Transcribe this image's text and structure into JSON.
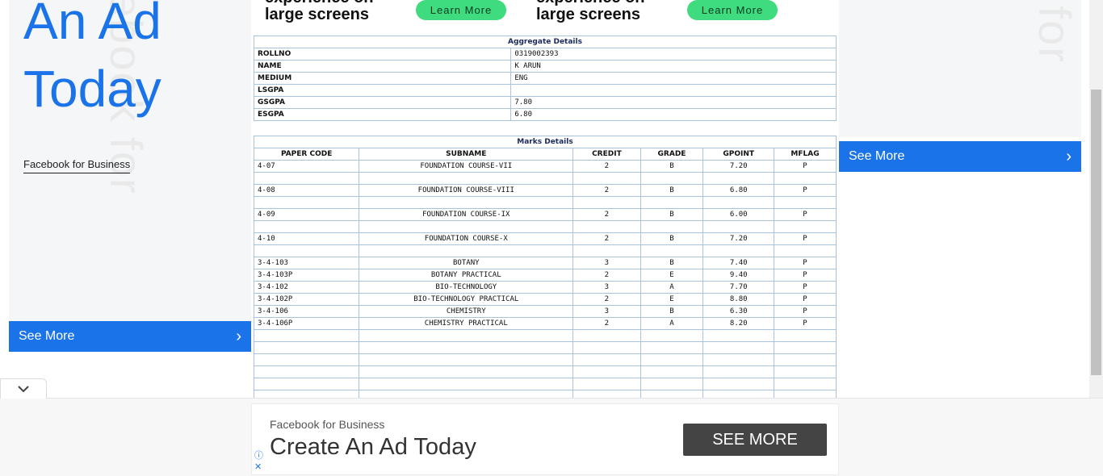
{
  "left_ad": {
    "headline_line1": "An Ad",
    "headline_line2": "Today",
    "vertical_text": "ebook for",
    "brand_link": "Facebook for Business",
    "see_more": "See More",
    "chevron": "›"
  },
  "right_ad": {
    "vertical_text": "k for",
    "see_more": "See More",
    "chevron": "›"
  },
  "top_banner": {
    "text_partial": "experience on",
    "text_line2": "large screens",
    "button_label": "Learn More"
  },
  "aggregate": {
    "title": "Aggregate Details",
    "rows": [
      {
        "label": "ROLLNO",
        "value": "0319002393"
      },
      {
        "label": "NAME",
        "value": "K ARUN"
      },
      {
        "label": "MEDIUM",
        "value": "ENG"
      },
      {
        "label": "LSGPA",
        "value": ""
      },
      {
        "label": "GSGPA",
        "value": "7.80"
      },
      {
        "label": "ESGPA",
        "value": "6.80"
      }
    ]
  },
  "marks": {
    "title": "Marks Details",
    "headers": [
      "PAPER CODE",
      "SUBNAME",
      "CREDIT",
      "GRADE",
      "GPOINT",
      "MFLAG"
    ],
    "rows": [
      [
        "4-07",
        "FOUNDATION COURSE-VII",
        "2",
        "B",
        "7.20",
        "P"
      ],
      [
        "",
        "",
        "",
        "",
        "",
        ""
      ],
      [
        "4-08",
        "FOUNDATION COURSE-VIII",
        "2",
        "B",
        "6.80",
        "P"
      ],
      [
        "",
        "",
        "",
        "",
        "",
        ""
      ],
      [
        "4-09",
        "FOUNDATION COURSE-IX",
        "2",
        "B",
        "6.00",
        "P"
      ],
      [
        "",
        "",
        "",
        "",
        "",
        ""
      ],
      [
        "4-10",
        "FOUNDATION COURSE-X",
        "2",
        "B",
        "7.20",
        "P"
      ],
      [
        "",
        "",
        "",
        "",
        "",
        ""
      ],
      [
        "3-4-103",
        "BOTANY",
        "3",
        "B",
        "7.40",
        "P"
      ],
      [
        "3-4-103P",
        "BOTANY PRACTICAL",
        "2",
        "E",
        "9.40",
        "P"
      ],
      [
        "3-4-102",
        "BIO-TECHNOLOGY",
        "3",
        "A",
        "7.70",
        "P"
      ],
      [
        "3-4-102P",
        "BIO-TECHNOLOGY PRACTICAL",
        "2",
        "E",
        "8.80",
        "P"
      ],
      [
        "3-4-106",
        "CHEMISTRY",
        "3",
        "B",
        "6.30",
        "P"
      ],
      [
        "3-4-106P",
        "CHEMISTRY PRACTICAL",
        "2",
        "A",
        "8.20",
        "P"
      ],
      [
        "",
        "",
        "",
        "",
        "",
        ""
      ],
      [
        "",
        "",
        "",
        "",
        "",
        ""
      ],
      [
        "",
        "",
        "",
        "",
        "",
        ""
      ],
      [
        "",
        "",
        "",
        "",
        "",
        ""
      ],
      [
        "",
        "",
        "",
        "",
        "",
        ""
      ],
      [
        "",
        "",
        "",
        "",
        "",
        ""
      ]
    ]
  },
  "bottom_ad": {
    "brand": "Facebook for Business",
    "headline": "Create An Ad Today",
    "button": "SEE MORE",
    "info_icon": "ⓘ",
    "close_icon": "✕"
  },
  "collapse_tab": {
    "icon": "chevron-down-icon"
  },
  "colors": {
    "accent": "#1a73e8",
    "learn_more": "#3fdb7f",
    "grid_border": "#a9c3de",
    "bottom_button": "#444444"
  }
}
